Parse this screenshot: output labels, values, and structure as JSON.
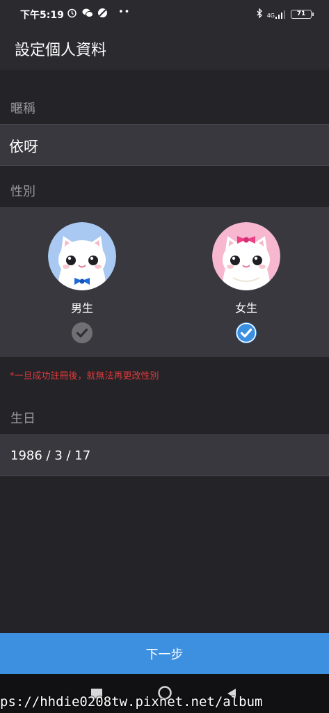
{
  "status_bar": {
    "time": "下午5:19",
    "network": "4G",
    "battery": "71"
  },
  "app_bar": {
    "title": "設定個人資料"
  },
  "nickname": {
    "label": "暱稱",
    "value": "依呀"
  },
  "gender": {
    "label": "性別",
    "options": [
      {
        "label": "男生",
        "selected": false
      },
      {
        "label": "女生",
        "selected": true
      }
    ],
    "warning": "*一旦成功註冊後，就無法再更改性別"
  },
  "birthday": {
    "label": "生日",
    "value": "1986 / 3 / 17"
  },
  "next_button": {
    "label": "下一步"
  },
  "watermark": "ps://hhdie0208tw.pixnet.net/album",
  "colors": {
    "background": "#232328",
    "field": "#38383e",
    "accent": "#3d8fe0",
    "warning": "#e03a3a",
    "male_avatar_bg": "#a9c9f2",
    "female_avatar_bg": "#f6b7cf"
  },
  "icons": [
    "alarm-icon",
    "wechat-icon",
    "no-disturb-icon",
    "bluetooth-icon",
    "signal-icon",
    "battery-icon",
    "check-icon",
    "recent-apps-icon",
    "home-icon",
    "back-icon"
  ]
}
